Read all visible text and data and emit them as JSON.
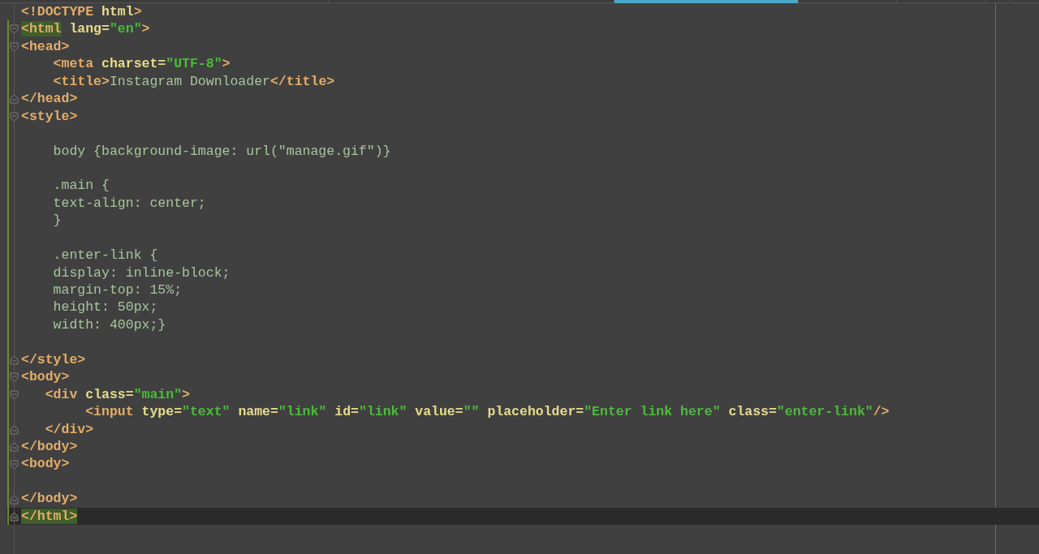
{
  "tabs": [
    {
      "selected": false
    },
    {
      "selected": false
    },
    {
      "selected": true
    },
    {
      "selected": false
    },
    {
      "selected": false
    },
    {
      "selected": false
    }
  ],
  "editor": {
    "lines": [
      {
        "fold_open": false,
        "fold_close": false,
        "current": false,
        "tokens": [
          {
            "kind": "tag",
            "text": "<!DOCTYPE "
          },
          {
            "kind": "attr",
            "text": "html"
          },
          {
            "kind": "tag",
            "text": ">"
          }
        ]
      },
      {
        "fold_open": true,
        "fold_close": false,
        "current": false,
        "tokens": [
          {
            "kind": "tag",
            "text": "<html",
            "matched": true
          },
          {
            "kind": "attr",
            "text": " lang="
          },
          {
            "kind": "string",
            "text": "\"en\""
          },
          {
            "kind": "tag",
            "text": ">"
          }
        ]
      },
      {
        "fold_open": true,
        "fold_close": false,
        "current": false,
        "tokens": [
          {
            "kind": "tag",
            "text": "<head>"
          }
        ]
      },
      {
        "fold_open": false,
        "fold_close": false,
        "current": false,
        "tokens": [
          {
            "kind": "tag",
            "text": "    <meta"
          },
          {
            "kind": "attr",
            "text": " charset="
          },
          {
            "kind": "string",
            "text": "\"UTF-8\""
          },
          {
            "kind": "tag",
            "text": ">"
          }
        ]
      },
      {
        "fold_open": false,
        "fold_close": false,
        "current": false,
        "tokens": [
          {
            "kind": "tag",
            "text": "    <title>"
          },
          {
            "kind": "text",
            "text": "Instagram Downloader"
          },
          {
            "kind": "tag",
            "text": "</title>"
          }
        ]
      },
      {
        "fold_open": false,
        "fold_close": true,
        "current": false,
        "tokens": [
          {
            "kind": "tag",
            "text": "</head>"
          }
        ]
      },
      {
        "fold_open": true,
        "fold_close": false,
        "current": false,
        "tokens": [
          {
            "kind": "tag",
            "text": "<style>"
          }
        ]
      },
      {
        "fold_open": false,
        "fold_close": false,
        "current": false
      },
      {
        "fold_open": false,
        "fold_close": false,
        "current": false,
        "tokens": [
          {
            "kind": "text",
            "text": "    body {background-image: url(\"manage.gif\")}"
          }
        ]
      },
      {
        "fold_open": false,
        "fold_close": false,
        "current": false
      },
      {
        "fold_open": false,
        "fold_close": false,
        "current": false,
        "tokens": [
          {
            "kind": "text",
            "text": "    .main {"
          }
        ]
      },
      {
        "fold_open": false,
        "fold_close": false,
        "current": false,
        "tokens": [
          {
            "kind": "text",
            "text": "    text-align: center;"
          }
        ]
      },
      {
        "fold_open": false,
        "fold_close": false,
        "current": false,
        "tokens": [
          {
            "kind": "text",
            "text": "    }"
          }
        ]
      },
      {
        "fold_open": false,
        "fold_close": false,
        "current": false
      },
      {
        "fold_open": false,
        "fold_close": false,
        "current": false,
        "tokens": [
          {
            "kind": "text",
            "text": "    .enter-link {"
          }
        ]
      },
      {
        "fold_open": false,
        "fold_close": false,
        "current": false,
        "tokens": [
          {
            "kind": "text",
            "text": "    display: inline-block;"
          }
        ]
      },
      {
        "fold_open": false,
        "fold_close": false,
        "current": false,
        "tokens": [
          {
            "kind": "text",
            "text": "    margin-top: 15%;"
          }
        ]
      },
      {
        "fold_open": false,
        "fold_close": false,
        "current": false,
        "tokens": [
          {
            "kind": "text",
            "text": "    height: 50px;"
          }
        ]
      },
      {
        "fold_open": false,
        "fold_close": false,
        "current": false,
        "tokens": [
          {
            "kind": "text",
            "text": "    width: 400px;}"
          }
        ]
      },
      {
        "fold_open": false,
        "fold_close": false,
        "current": false
      },
      {
        "fold_open": false,
        "fold_close": true,
        "current": false,
        "tokens": [
          {
            "kind": "tag",
            "text": "</style>"
          }
        ]
      },
      {
        "fold_open": true,
        "fold_close": false,
        "current": false,
        "tokens": [
          {
            "kind": "tag",
            "text": "<body>"
          }
        ]
      },
      {
        "fold_open": true,
        "fold_close": false,
        "current": false,
        "tokens": [
          {
            "kind": "tag",
            "text": "   <div"
          },
          {
            "kind": "attr",
            "text": " class="
          },
          {
            "kind": "string",
            "text": "\"main\""
          },
          {
            "kind": "tag",
            "text": ">"
          }
        ]
      },
      {
        "fold_open": false,
        "fold_close": false,
        "current": false,
        "tokens": [
          {
            "kind": "tag",
            "text": "        <input"
          },
          {
            "kind": "attr",
            "text": " type="
          },
          {
            "kind": "string",
            "text": "\"text\""
          },
          {
            "kind": "attr",
            "text": " name="
          },
          {
            "kind": "string",
            "text": "\"link\""
          },
          {
            "kind": "attr",
            "text": " id="
          },
          {
            "kind": "string",
            "text": "\"link\""
          },
          {
            "kind": "attr",
            "text": " value="
          },
          {
            "kind": "string",
            "text": "\"\""
          },
          {
            "kind": "attr",
            "text": " placeholder="
          },
          {
            "kind": "string",
            "text": "\"Enter link here\""
          },
          {
            "kind": "attr",
            "text": " class="
          },
          {
            "kind": "string",
            "text": "\"enter-link\""
          },
          {
            "kind": "tag",
            "text": "/>"
          }
        ]
      },
      {
        "fold_open": false,
        "fold_close": true,
        "current": false,
        "tokens": [
          {
            "kind": "tag",
            "text": "   </div>"
          }
        ]
      },
      {
        "fold_open": false,
        "fold_close": true,
        "current": false,
        "tokens": [
          {
            "kind": "tag",
            "text": "</body>"
          }
        ]
      },
      {
        "fold_open": true,
        "fold_close": false,
        "current": false,
        "tokens": [
          {
            "kind": "tag",
            "text": "<body>"
          }
        ]
      },
      {
        "fold_open": false,
        "fold_close": false,
        "current": false
      },
      {
        "fold_open": false,
        "fold_close": true,
        "current": false,
        "tokens": [
          {
            "kind": "tag",
            "text": "</body>"
          }
        ]
      },
      {
        "fold_open": false,
        "fold_close": true,
        "current": true,
        "tokens": [
          {
            "kind": "tag",
            "text": "</html>",
            "matched": true
          }
        ]
      }
    ]
  }
}
